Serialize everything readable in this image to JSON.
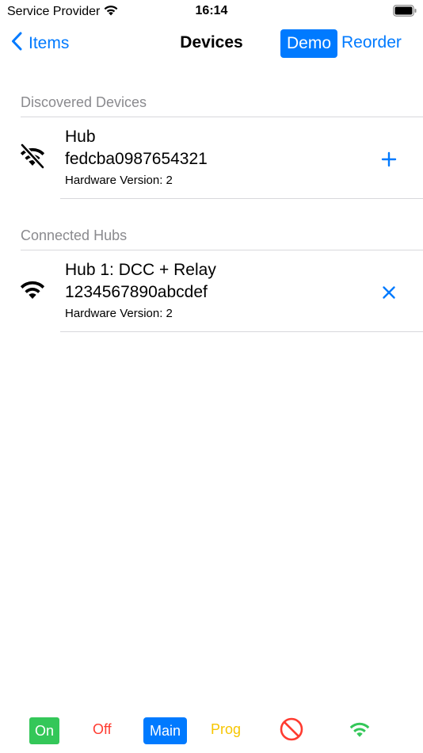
{
  "status_bar": {
    "carrier": "Service Provider",
    "time": "16:14",
    "wifi_icon": "wifi-icon",
    "battery_icon": "battery-icon"
  },
  "nav": {
    "back_label": "Items",
    "title": "Devices",
    "demo_label": "Demo",
    "reorder_label": "Reorder"
  },
  "sections": {
    "discovered": {
      "header": "Discovered Devices",
      "items": [
        {
          "name": "Hub",
          "id": "fedcba0987654321",
          "hardware": "Hardware Version: 2",
          "icon": "wifi-off-icon",
          "action_icon": "plus-icon"
        }
      ]
    },
    "connected": {
      "header": "Connected Hubs",
      "items": [
        {
          "name": "Hub 1: DCC + Relay",
          "id": "1234567890abcdef",
          "hardware": "Hardware Version: 2",
          "icon": "wifi-icon",
          "action_icon": "close-icon"
        }
      ]
    }
  },
  "toolbar": {
    "on_label": "On",
    "off_label": "Off",
    "main_label": "Main",
    "prog_label": "Prog",
    "stop_icon": "prohibited-icon",
    "wifi_icon": "wifi-icon"
  },
  "colors": {
    "accent": "#007aff",
    "green": "#34c759",
    "red": "#ff3b30",
    "yellow": "#f7c600",
    "section_header": "#8a8a8e"
  }
}
